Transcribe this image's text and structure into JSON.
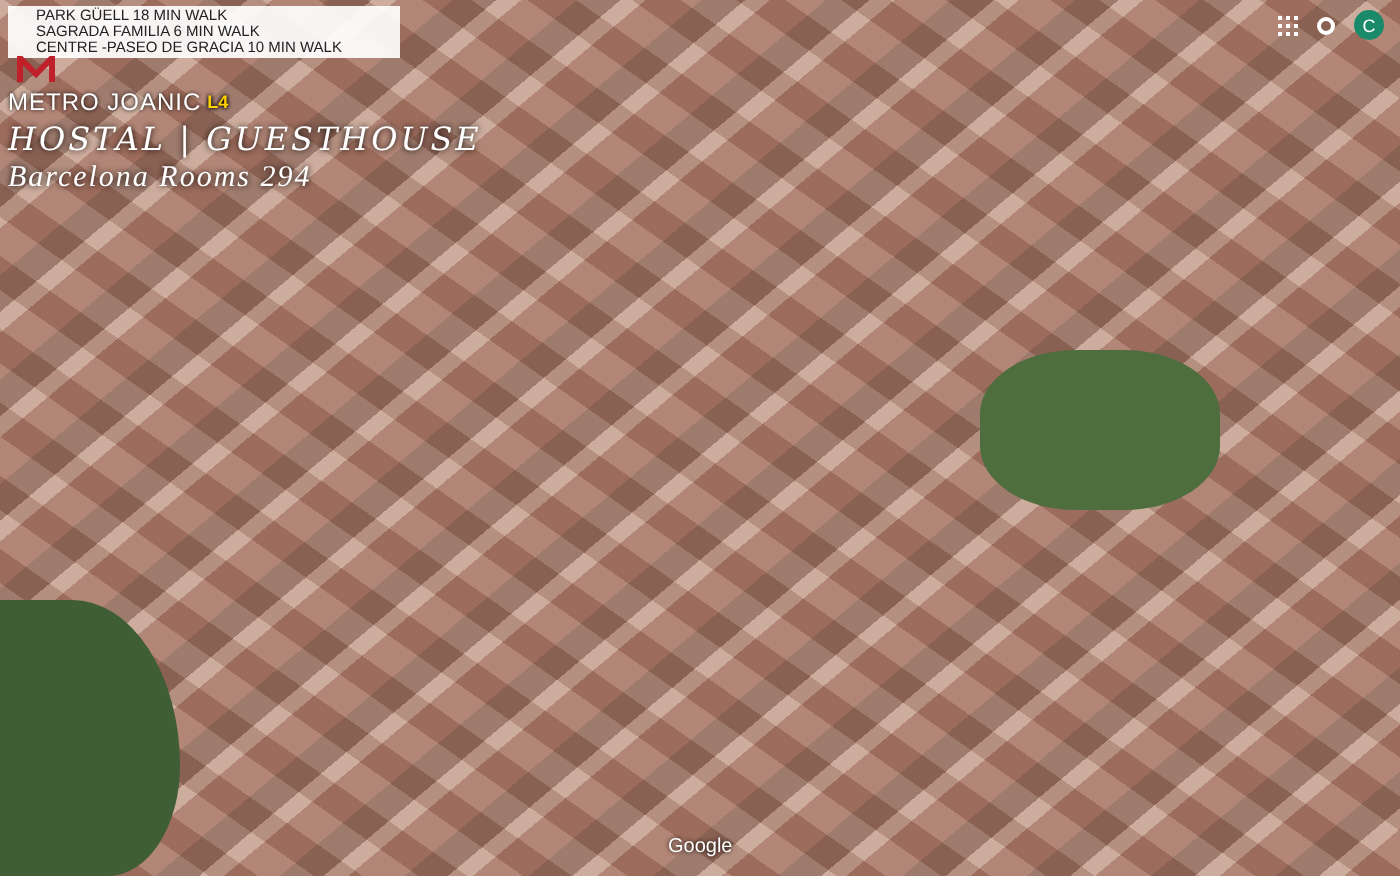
{
  "info_box": {
    "lines": [
      "PARK GÜELL 18 MIN WALK",
      "SAGRADA FAMILIA 6 MIN WALK",
      "CENTRE -PASEO DE GRACIA 10 MIN WALK"
    ]
  },
  "logo": {
    "metro": "METRO JOANIC",
    "metro_line": "L4",
    "title": "HOSTAL | GUESTHOUSE",
    "subtitle": "Barcelona Rooms 294"
  },
  "account": {
    "initial": "C"
  },
  "attribution": "Google"
}
